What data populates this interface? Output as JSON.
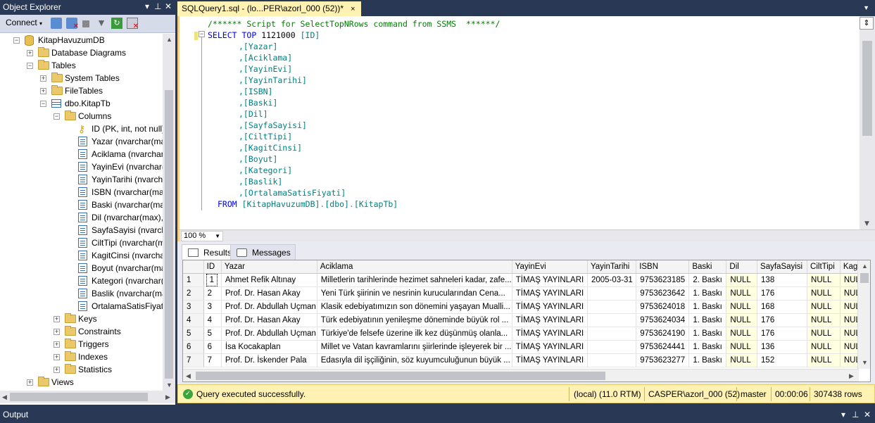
{
  "object_explorer": {
    "title": "Object Explorer",
    "connect_label": "Connect",
    "tree": [
      {
        "label": "KitapHavuzumDB",
        "icon": "database-icon",
        "expander": "minus"
      },
      {
        "label": "Database Diagrams",
        "icon": "folder-icon",
        "expander": "plus"
      },
      {
        "label": "Tables",
        "icon": "folder-icon",
        "expander": "minus"
      },
      {
        "label": "System Tables",
        "icon": "folder-icon",
        "expander": "plus"
      },
      {
        "label": "FileTables",
        "icon": "folder-icon",
        "expander": "plus"
      },
      {
        "label": "dbo.KitapTb",
        "icon": "table-icon",
        "expander": "minus"
      },
      {
        "label": "Columns",
        "icon": "folder-icon",
        "expander": "minus"
      },
      {
        "label": "ID (PK, int, not null)",
        "icon": "key-icon"
      },
      {
        "label": "Yazar (nvarchar(max),",
        "icon": "column-icon"
      },
      {
        "label": "Aciklama (nvarchar(ma",
        "icon": "column-icon"
      },
      {
        "label": "YayinEvi (nvarchar(ma",
        "icon": "column-icon"
      },
      {
        "label": "YayinTarihi (nvarchar(m",
        "icon": "column-icon"
      },
      {
        "label": "ISBN (nvarchar(max), n",
        "icon": "column-icon"
      },
      {
        "label": "Baski (nvarchar(max), n",
        "icon": "column-icon"
      },
      {
        "label": "Dil (nvarchar(max), nu",
        "icon": "column-icon"
      },
      {
        "label": "SayfaSayisi (nvarchar(m",
        "icon": "column-icon"
      },
      {
        "label": "CiltTipi (nvarchar(max",
        "icon": "column-icon"
      },
      {
        "label": "KagitCinsi (nvarchar(m",
        "icon": "column-icon"
      },
      {
        "label": "Boyut (nvarchar(max),",
        "icon": "column-icon"
      },
      {
        "label": "Kategori (nvarchar(ma",
        "icon": "column-icon"
      },
      {
        "label": "Baslik (nvarchar(max),",
        "icon": "column-icon"
      },
      {
        "label": "OrtalamaSatisFiyati (nv",
        "icon": "column-icon"
      },
      {
        "label": "Keys",
        "icon": "folder-icon",
        "expander": "plus"
      },
      {
        "label": "Constraints",
        "icon": "folder-icon",
        "expander": "plus"
      },
      {
        "label": "Triggers",
        "icon": "folder-icon",
        "expander": "plus"
      },
      {
        "label": "Indexes",
        "icon": "folder-icon",
        "expander": "plus"
      },
      {
        "label": "Statistics",
        "icon": "folder-icon",
        "expander": "plus"
      },
      {
        "label": "Views",
        "icon": "folder-icon",
        "expander": "plus"
      }
    ]
  },
  "document_tab": {
    "title": "SQLQuery1.sql - (lo...PER\\azorl_000 (52))*",
    "close": "×"
  },
  "editor": {
    "zoom": "100 %",
    "comment": "/****** Script for SelectTopNRows command from SSMS  ******/",
    "select_kw": "SELECT",
    "top_kw": "TOP",
    "top_n": "1121000",
    "first_col": "[ID]",
    "columns": [
      ",[Yazar]",
      ",[Aciklama]",
      ",[YayinEvi]",
      ",[YayinTarihi]",
      ",[ISBN]",
      ",[Baski]",
      ",[Dil]",
      ",[SayfaSayisi]",
      ",[CiltTipi]",
      ",[KagitCinsi]",
      ",[Boyut]",
      ",[Kategori]",
      ",[Baslik]",
      ",[OrtalamaSatisFiyati]"
    ],
    "from_kw": "FROM",
    "from_db": "[KitapHavuzumDB]",
    "from_schema": "[dbo]",
    "from_table": "[KitapTb]"
  },
  "results": {
    "tab_results": "Results",
    "tab_messages": "Messages",
    "columns": [
      "",
      "ID",
      "Yazar",
      "Aciklama",
      "YayinEvi",
      "YayinTarihi",
      "ISBN",
      "Baski",
      "Dil",
      "SayfaSayisi",
      "CiltTipi",
      "KagitCi"
    ],
    "rows": [
      [
        "1",
        "1",
        "Ahmet Refik Altınay",
        "Milletlerin tarihlerinde hezimet sahneleri kadar, zafe...",
        "TİMAŞ YAYINLARI",
        "2005-03-31",
        "9753623185",
        "2. Baskı",
        "NULL",
        "138",
        "NULL",
        "NUL"
      ],
      [
        "2",
        "2",
        "Prof. Dr. Hasan Akay",
        "Yeni Türk şiirinin ve nesrinin kurucularından Cena...",
        "TİMAŞ YAYINLARI",
        "",
        "9753623642",
        "1. Baskı",
        "NULL",
        "176",
        "NULL",
        "NUL"
      ],
      [
        "3",
        "3",
        "Prof. Dr. Abdullah Uçman",
        "Klasik edebiyatımızın son dönemini yaşayan Mualli...",
        "TİMAŞ YAYINLARI",
        "",
        "9753624018",
        "1. Baskı",
        "NULL",
        "168",
        "NULL",
        "NUL"
      ],
      [
        "4",
        "4",
        "Prof. Dr. Hasan Akay",
        "Türk edebiyatının yenileşme döneminde büyük rol ...",
        "TİMAŞ YAYINLARI",
        "",
        "9753624034",
        "1. Baskı",
        "NULL",
        "176",
        "NULL",
        "NUL"
      ],
      [
        "5",
        "5",
        "Prof. Dr. Abdullah Uçman",
        "Türkiye'de felsefe üzerine ilk kez düşünmüş olanla...",
        "TİMAŞ YAYINLARI",
        "",
        "9753624190",
        "1. Baskı",
        "NULL",
        "176",
        "NULL",
        "NUL"
      ],
      [
        "6",
        "6",
        "İsa Kocakaplan",
        "Millet ve Vatan kavramlarını şiirlerinde işleyerek bir ...",
        "TİMAŞ YAYINLARI",
        "",
        "9753624441",
        "1. Baskı",
        "NULL",
        "136",
        "NULL",
        "NUL"
      ],
      [
        "7",
        "7",
        "Prof. Dr. İskender Pala",
        "Edasıyla dil işçiliğinin, söz kuyumculuğunun büyük ...",
        "TİMAŞ YAYINLARI",
        "",
        "9753623277",
        "1. Baskı",
        "NULL",
        "152",
        "NULL",
        "NUL"
      ]
    ]
  },
  "status": {
    "message": "Query executed successfully.",
    "server": "(local) (11.0 RTM)",
    "user": "CASPER\\azorl_000 (52)",
    "database": "master",
    "elapsed": "00:00:06",
    "rows": "307438 rows"
  },
  "output": {
    "title": "Output"
  }
}
